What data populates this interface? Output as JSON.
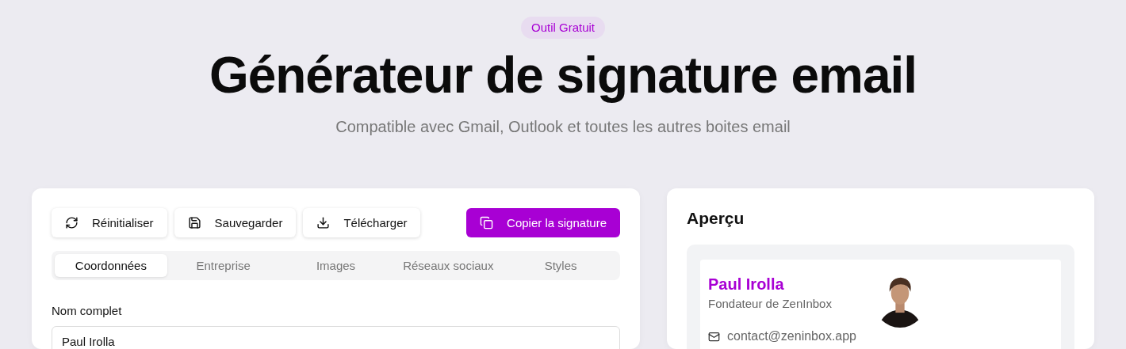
{
  "badge": "Outil Gratuit",
  "title": "Générateur de signature email",
  "subtitle": "Compatible avec Gmail, Outlook et toutes les autres boites email",
  "toolbar": [
    {
      "kind": "reset",
      "label": "Réinitialiser"
    },
    {
      "kind": "save",
      "label": "Sauvegarder"
    },
    {
      "kind": "download",
      "label": "Télécharger"
    }
  ],
  "primary_action": {
    "label": "Copier la signature"
  },
  "tabs": [
    {
      "label": "Coordonnées",
      "selected": true
    },
    {
      "label": "Entreprise",
      "selected": false
    },
    {
      "label": "Images",
      "selected": false
    },
    {
      "label": "Réseaux sociaux",
      "selected": false
    },
    {
      "label": "Styles",
      "selected": false
    }
  ],
  "fields": [
    {
      "label": "Nom complet",
      "value": "Paul Irolla"
    }
  ],
  "preview": {
    "title": "Aperçu",
    "name": "Paul Irolla",
    "role": "Fondateur de ZenInbox",
    "contacts": [
      {
        "kind": "email",
        "text": "contact@zeninbox.app"
      }
    ]
  }
}
